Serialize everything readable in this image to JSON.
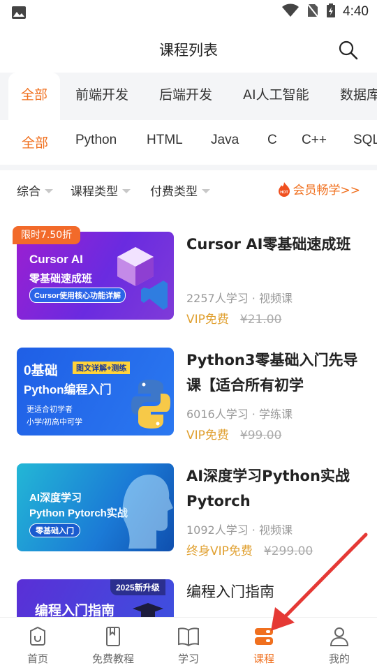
{
  "status": {
    "time": "4:40"
  },
  "header": {
    "title": "课程列表"
  },
  "categories": [
    "全部",
    "前端开发",
    "后端开发",
    "AI人工智能",
    "数据库"
  ],
  "subcategories": [
    "全部",
    "Python",
    "HTML",
    "Java",
    "C",
    "C++",
    "SQL"
  ],
  "filters": {
    "sort": "综合",
    "course_type": "课程类型",
    "pay_type": "付费类型",
    "vip_link": "会员畅学>>",
    "hot_badge": "HOT"
  },
  "courses": [
    {
      "title": "Cursor AI零基础速成班",
      "meta": "2257人学习 · 视频课",
      "vip_label": "VIP免费",
      "original_price": "¥21.00",
      "discount": "限时7.50折",
      "thumb": {
        "line1": "Cursor AI",
        "line2": "零基础速成班",
        "pill": "Cursor使用核心功能详解"
      }
    },
    {
      "title": "Python3零基础入门先导课【适合所有初学",
      "meta": "6016人学习 · 学练课",
      "vip_label": "VIP免费",
      "original_price": "¥99.00",
      "thumb": {
        "line1": "0基础",
        "tag": "图文详解+测练",
        "line2": "Python编程入门",
        "note1": "更适合初学者",
        "note2": "小学/初高中可学"
      }
    },
    {
      "title": "AI深度学习Python实战Pytorch",
      "meta": "1092人学习 · 视频课",
      "vip_label": "终身VIP免费",
      "original_price": "¥299.00",
      "thumb": {
        "line1": "AI深度学习",
        "line2": "Python Pytorch实战",
        "pill": "零基础入门"
      }
    },
    {
      "title": "编程入门指南",
      "thumb": {
        "line1": "编程入门指南",
        "badge": "2025新升级"
      }
    }
  ],
  "nav": [
    {
      "label": "首页",
      "icon": "home-icon"
    },
    {
      "label": "免费教程",
      "icon": "bookmark-icon"
    },
    {
      "label": "学习",
      "icon": "book-open-icon"
    },
    {
      "label": "课程",
      "icon": "course-stack-icon",
      "active": true
    },
    {
      "label": "我的",
      "icon": "user-icon"
    }
  ],
  "colors": {
    "accent": "#f0701f",
    "vip": "#e0a030",
    "annotation_arrow": "#e53935"
  }
}
